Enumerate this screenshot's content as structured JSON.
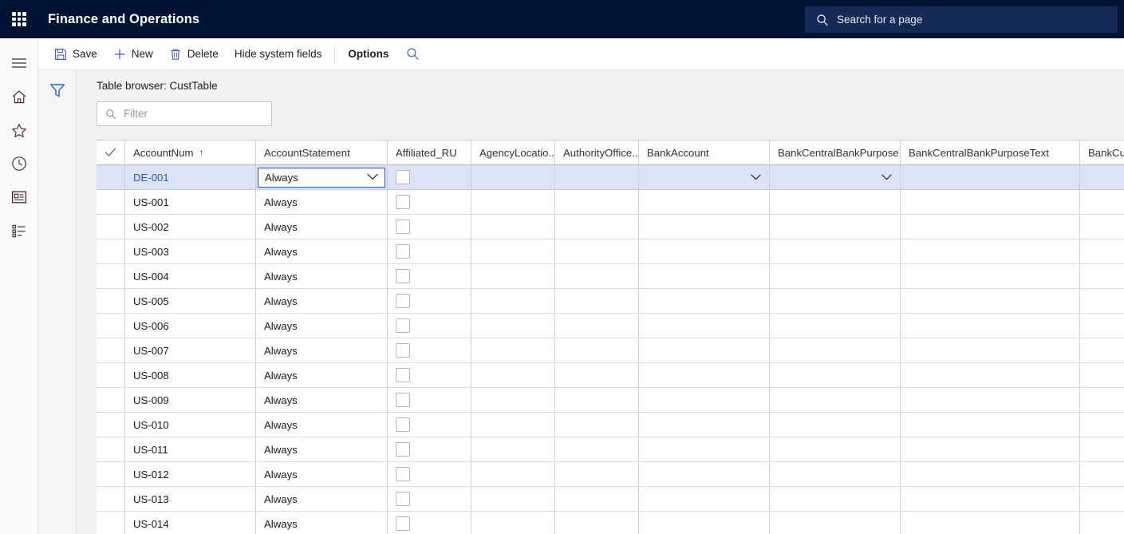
{
  "topnav": {
    "waffle_icon": "app-launcher-icon",
    "app_title": "Finance and Operations",
    "search": {
      "icon": "search-icon",
      "placeholder": "Search for a page"
    }
  },
  "rail": {
    "items": [
      {
        "icon": "hamburger-menu-icon",
        "name": "nav-toggle"
      },
      {
        "icon": "home-icon",
        "name": "home"
      },
      {
        "icon": "star-icon",
        "name": "favorites"
      },
      {
        "icon": "clock-icon",
        "name": "recent"
      },
      {
        "icon": "workspace-icon",
        "name": "workspaces"
      },
      {
        "icon": "list-icon",
        "name": "modules"
      }
    ]
  },
  "actionbar": {
    "buttons": [
      {
        "label": "Save",
        "icon": "save-icon"
      },
      {
        "label": "New",
        "icon": "plus-icon"
      },
      {
        "label": "Delete",
        "icon": "trash-icon"
      },
      {
        "label": "Hide system fields",
        "icon": ""
      },
      {
        "label": "Options",
        "icon": ""
      }
    ],
    "search_icon": "search-icon"
  },
  "filterpane": {
    "icon": "filter-funnel-icon"
  },
  "pane": {
    "title": "Table browser: CustTable",
    "filter": {
      "icon": "search-icon",
      "placeholder": "Filter",
      "value": ""
    }
  },
  "grid": {
    "select_all_icon": "checkmark-icon",
    "columns": [
      {
        "key": "check",
        "label": "",
        "sort": ""
      },
      {
        "key": "acct",
        "label": "AccountNum",
        "sort": "↑"
      },
      {
        "key": "stmt",
        "label": "AccountStatement",
        "sort": ""
      },
      {
        "key": "aff",
        "label": "Affiliated_RU",
        "sort": ""
      },
      {
        "key": "agency",
        "label": "AgencyLocatio...",
        "sort": ""
      },
      {
        "key": "auth",
        "label": "AuthorityOffice...",
        "sort": ""
      },
      {
        "key": "bank",
        "label": "BankAccount",
        "sort": ""
      },
      {
        "key": "bcbp",
        "label": "BankCentralBankPurpose...",
        "sort": ""
      },
      {
        "key": "bcbt",
        "label": "BankCentralBankPurposeText",
        "sort": ""
      },
      {
        "key": "bcust",
        "label": "BankCust",
        "sort": ""
      }
    ],
    "active_cell": {
      "column": "AccountStatement",
      "value": "Always",
      "chevron_icon": "chevron-down-icon"
    },
    "rows": [
      {
        "acct": "DE-001",
        "stmt": "Always",
        "aff": false,
        "agency": "",
        "auth": "",
        "bank": "",
        "bcbp": "",
        "bcbt": "",
        "bcust": "",
        "selected": true
      },
      {
        "acct": "US-001",
        "stmt": "Always",
        "aff": false,
        "agency": "",
        "auth": "",
        "bank": "",
        "bcbp": "",
        "bcbt": "",
        "bcust": "",
        "selected": false
      },
      {
        "acct": "US-002",
        "stmt": "Always",
        "aff": false,
        "agency": "",
        "auth": "",
        "bank": "",
        "bcbp": "",
        "bcbt": "",
        "bcust": "",
        "selected": false
      },
      {
        "acct": "US-003",
        "stmt": "Always",
        "aff": false,
        "agency": "",
        "auth": "",
        "bank": "",
        "bcbp": "",
        "bcbt": "",
        "bcust": "",
        "selected": false
      },
      {
        "acct": "US-004",
        "stmt": "Always",
        "aff": false,
        "agency": "",
        "auth": "",
        "bank": "",
        "bcbp": "",
        "bcbt": "",
        "bcust": "",
        "selected": false
      },
      {
        "acct": "US-005",
        "stmt": "Always",
        "aff": false,
        "agency": "",
        "auth": "",
        "bank": "",
        "bcbp": "",
        "bcbt": "",
        "bcust": "",
        "selected": false
      },
      {
        "acct": "US-006",
        "stmt": "Always",
        "aff": false,
        "agency": "",
        "auth": "",
        "bank": "",
        "bcbp": "",
        "bcbt": "",
        "bcust": "",
        "selected": false
      },
      {
        "acct": "US-007",
        "stmt": "Always",
        "aff": false,
        "agency": "",
        "auth": "",
        "bank": "",
        "bcbp": "",
        "bcbt": "",
        "bcust": "",
        "selected": false
      },
      {
        "acct": "US-008",
        "stmt": "Always",
        "aff": false,
        "agency": "",
        "auth": "",
        "bank": "",
        "bcbp": "",
        "bcbt": "",
        "bcust": "",
        "selected": false
      },
      {
        "acct": "US-009",
        "stmt": "Always",
        "aff": false,
        "agency": "",
        "auth": "",
        "bank": "",
        "bcbp": "",
        "bcbt": "",
        "bcust": "",
        "selected": false
      },
      {
        "acct": "US-010",
        "stmt": "Always",
        "aff": false,
        "agency": "",
        "auth": "",
        "bank": "",
        "bcbp": "",
        "bcbt": "",
        "bcust": "",
        "selected": false
      },
      {
        "acct": "US-011",
        "stmt": "Always",
        "aff": false,
        "agency": "",
        "auth": "",
        "bank": "",
        "bcbp": "",
        "bcbt": "",
        "bcust": "",
        "selected": false
      },
      {
        "acct": "US-012",
        "stmt": "Always",
        "aff": false,
        "agency": "",
        "auth": "",
        "bank": "",
        "bcbp": "",
        "bcbt": "",
        "bcust": "",
        "selected": false
      },
      {
        "acct": "US-013",
        "stmt": "Always",
        "aff": false,
        "agency": "",
        "auth": "",
        "bank": "",
        "bcbp": "",
        "bcbt": "",
        "bcust": "",
        "selected": false
      },
      {
        "acct": "US-014",
        "stmt": "Always",
        "aff": false,
        "agency": "",
        "auth": "",
        "bank": "",
        "bcbp": "",
        "bcbt": "",
        "bcust": "",
        "selected": false
      }
    ]
  },
  "colors": {
    "nav_bg": "#001233",
    "nav_search_bg": "#152a54",
    "accent_link": "#2b5cb8",
    "selected_row": "#dbe3f7",
    "active_border": "#1f5cbf",
    "pane_bg": "#f2f2f2",
    "icon_blue": "#3b5cc4"
  }
}
